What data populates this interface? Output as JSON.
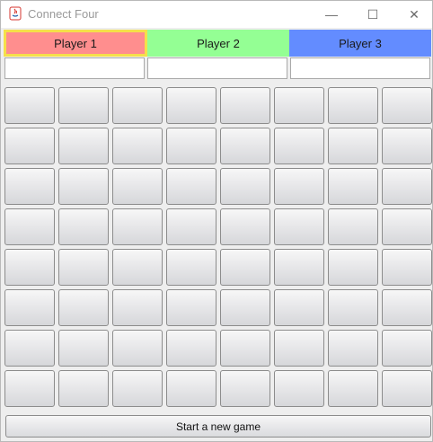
{
  "window": {
    "title": "Connect Four",
    "minimize_glyph": "—",
    "maximize_glyph": "☐",
    "close_glyph": "✕"
  },
  "players": [
    {
      "label": "Player 1",
      "color": "#ff8e8e",
      "active": true,
      "name_value": ""
    },
    {
      "label": "Player 2",
      "color": "#94ff94",
      "active": false,
      "name_value": ""
    },
    {
      "label": "Player 3",
      "color": "#638cff",
      "active": false,
      "name_value": ""
    }
  ],
  "board": {
    "rows": 8,
    "cols": 8
  },
  "actions": {
    "new_game_label": "Start a new game"
  },
  "colors": {
    "active_outline": "#f5e04a"
  }
}
